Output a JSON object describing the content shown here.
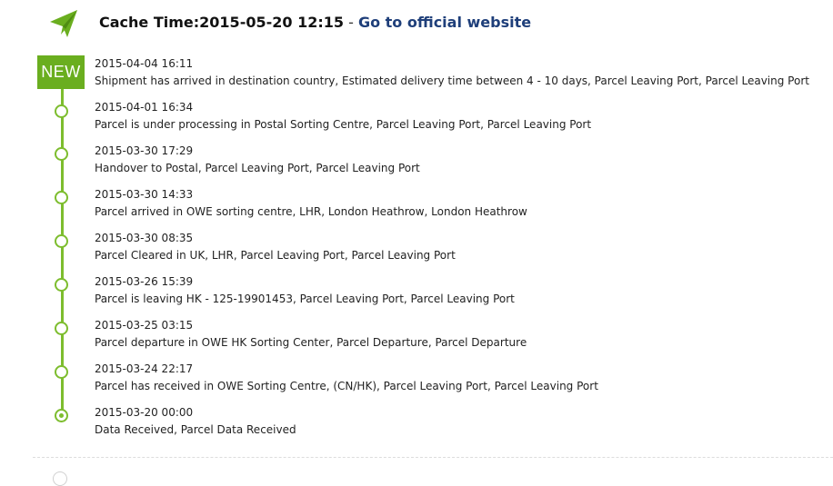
{
  "header": {
    "icon": "paper-plane-icon",
    "cache_label": "Cache Time:",
    "cache_time": "2015-05-20 12:15",
    "separator": " - ",
    "link_text": "Go to official website"
  },
  "badge": {
    "label": "NEW"
  },
  "colors": {
    "accent_green": "#6aae1f",
    "line_green": "#7dbd2e",
    "link_blue": "#1f3f7a"
  },
  "events": [
    {
      "time": "2015-04-04 16:11",
      "desc": "Shipment has arrived in destination country, Estimated delivery time between 4 - 10 days, Parcel Leaving Port, Parcel Leaving Port"
    },
    {
      "time": "2015-04-01 16:34",
      "desc": "Parcel is under processing in Postal Sorting Centre, Parcel Leaving Port, Parcel Leaving Port"
    },
    {
      "time": "2015-03-30 17:29",
      "desc": "Handover to Postal, Parcel Leaving Port, Parcel Leaving Port"
    },
    {
      "time": "2015-03-30 14:33",
      "desc": "Parcel arrived in OWE sorting centre, LHR, London Heathrow, London Heathrow"
    },
    {
      "time": "2015-03-30 08:35",
      "desc": "Parcel Cleared in UK, LHR, Parcel Leaving Port, Parcel Leaving Port"
    },
    {
      "time": "2015-03-26 15:39",
      "desc": "Parcel is leaving HK - 125-19901453, Parcel Leaving Port, Parcel Leaving Port"
    },
    {
      "time": "2015-03-25 03:15",
      "desc": "Parcel departure in OWE HK Sorting Center, Parcel Departure, Parcel Departure"
    },
    {
      "time": "2015-03-24 22:17",
      "desc": "Parcel has received in OWE Sorting Centre, (CN/HK), Parcel Leaving Port, Parcel Leaving Port"
    },
    {
      "time": "2015-03-20 00:00",
      "desc": "Data Received, Parcel Data Received"
    }
  ]
}
